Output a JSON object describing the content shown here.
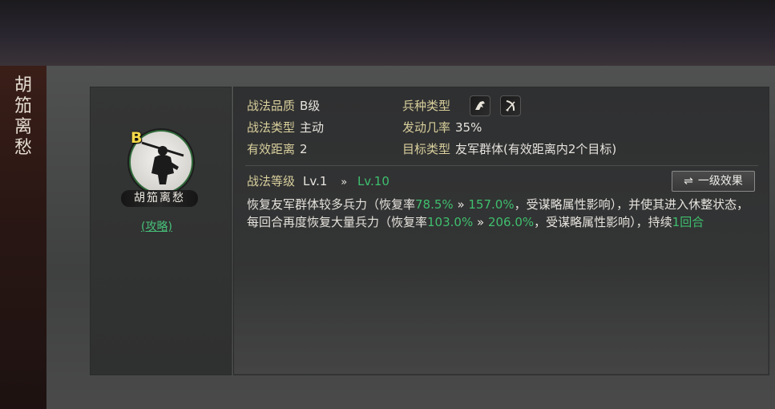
{
  "side_title": "胡笳离愁",
  "skill": {
    "grade": "B",
    "banner_name": "胡笳离愁",
    "guide_link": "(攻略)"
  },
  "attributes": {
    "quality_label": "战法品质",
    "quality_value": "B级",
    "troop_label": "兵种类型",
    "troop_icons": [
      "cavalry-icon",
      "archer-icon"
    ],
    "type_label": "战法类型",
    "type_value": "主动",
    "rate_label": "发动几率",
    "rate_value": "35%",
    "range_label": "有效距离",
    "range_value": "2",
    "target_label": "目标类型",
    "target_value": "友军群体(有效距离内2个目标)"
  },
  "level": {
    "label": "战法等级",
    "current": "Lv.1",
    "arrow": "»",
    "next": "Lv.10"
  },
  "toggle_button": {
    "icon": "⇌",
    "label": "一级效果"
  },
  "description": {
    "p1": "恢复友军群体较多兵力（恢复率",
    "v1a": "78.5%",
    "arrow": " » ",
    "v1b": "157.0%",
    "p2": "，受谋略属性影响），并使其进入休整状态，每回合再度恢复大量兵力（恢复率",
    "v2a": "103.0%",
    "v2b": "206.0%",
    "p3": "，受谋略属性影响），持续",
    "v3": "1回合"
  },
  "colors": {
    "label": "#d8cf9c",
    "green": "#3fbf6e",
    "grade_yellow": "#f2d74a"
  }
}
